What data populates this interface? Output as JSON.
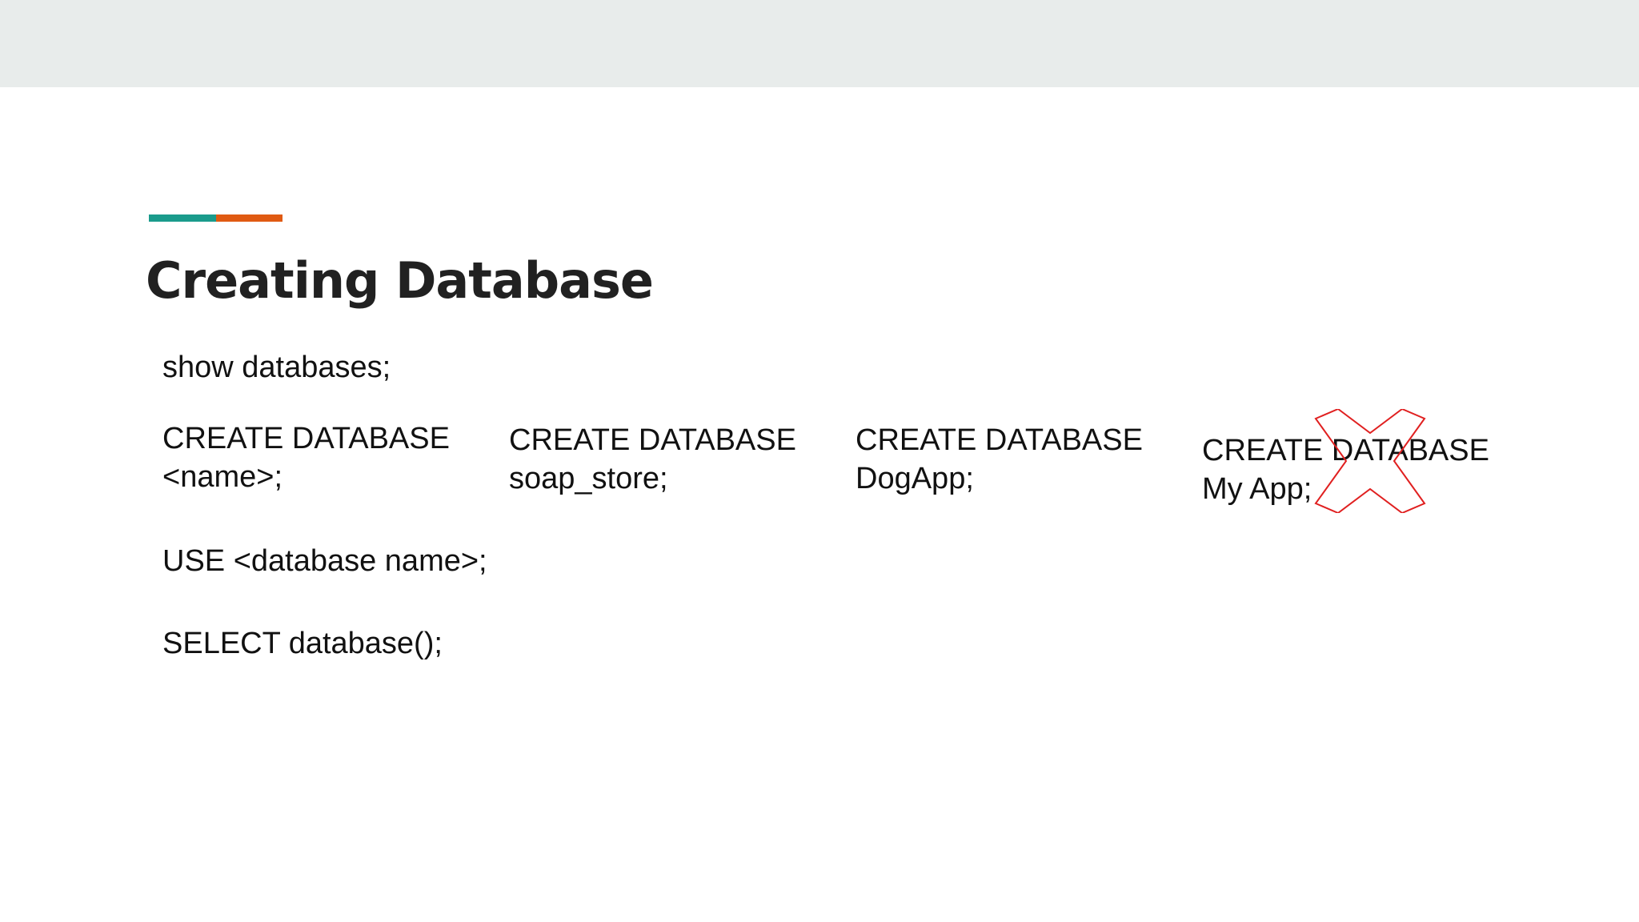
{
  "slide": {
    "title": "Creating Database",
    "accent_colors": [
      "#1a9b8c",
      "#e05a12"
    ],
    "show_statement": "show databases;",
    "create_examples": [
      {
        "line1": "CREATE DATABASE",
        "line2": "<name>;"
      },
      {
        "line1": "CREATE DATABASE",
        "line2": "soap_store;"
      },
      {
        "line1": "CREATE DATABASE",
        "line2": "DogApp;"
      },
      {
        "line1": "CREATE DATABASE",
        "line2": "My App;"
      }
    ],
    "invalid_marker": {
      "icon": "x-cross-icon",
      "color": "#e02020"
    },
    "use_statement": "USE <database name>;",
    "select_statement": "SELECT database();"
  }
}
